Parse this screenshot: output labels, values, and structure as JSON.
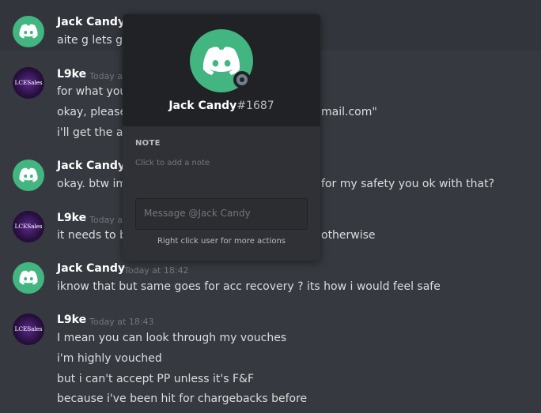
{
  "messages": [
    {
      "author": "Jack Candy",
      "timestamp": "",
      "lines": [
        "aite g lets go"
      ]
    },
    {
      "author": "L9ke",
      "timestamp": "Today at 18:42",
      "lines": [
        "for what you",
        "okay, please",
        "i'll get the ac"
      ],
      "trailing": {
        "line2": "mail.com\""
      }
    },
    {
      "author": "Jack Candy",
      "timestamp": "",
      "lines": [
        "okay. btw im"
      ],
      "trailing": {
        "line1": "for my safety you ok with that?"
      }
    },
    {
      "author": "L9ke",
      "timestamp": "Today at 18:42",
      "lines": [
        "it needs to b"
      ],
      "trailing": {
        "line1": "otherwise"
      }
    },
    {
      "author": "Jack Candy",
      "timestamp": "Today at 18:42",
      "lines": [
        "iknow that but same goes for acc recovery ? its how i would feel safe"
      ]
    },
    {
      "author": "L9ke",
      "timestamp": "Today at 18:43",
      "lines": [
        "I mean you can look through my vouches",
        "i'm highly vouched",
        "but i can't accept PP unless it's F&F",
        "because i've been hit for chargebacks before"
      ]
    }
  ],
  "avatar_text": "LCESales",
  "popout": {
    "username": "Jack Candy",
    "discriminator": "#1687",
    "note_title": "NOTE",
    "note_placeholder": "Click to add a note",
    "message_placeholder": "Message @Jack Candy",
    "hint": "Right click user for more actions"
  },
  "colors": {
    "background": "#36393f",
    "popout": "#2f3136",
    "popout_header": "#202225",
    "discord_green": "#43b581"
  }
}
